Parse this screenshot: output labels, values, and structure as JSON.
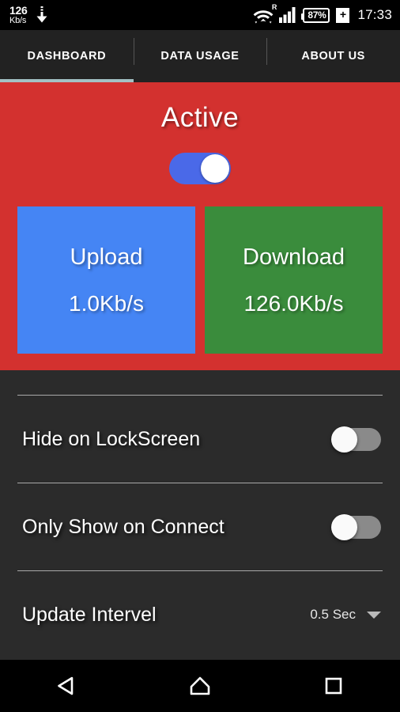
{
  "statusbar": {
    "speed_value": "126",
    "speed_unit": "Kb/s",
    "download_arrow_icon": "download-arrow-icon",
    "wifi_icon": "wifi-icon",
    "roaming_label": "R",
    "signal_icon": "cellular-signal-icon",
    "battery_percent": "87%",
    "battery_plus": "+",
    "clock": "17:33"
  },
  "tabs": [
    {
      "label": "DASHBOARD",
      "active": true
    },
    {
      "label": "DATA USAGE",
      "active": false
    },
    {
      "label": "ABOUT US",
      "active": false
    }
  ],
  "dashboard": {
    "status_title": "Active",
    "master_switch_on": true,
    "cards": [
      {
        "title": "Upload",
        "value": "1.0Kb/s",
        "color": "#4585f4"
      },
      {
        "title": "Download",
        "value": "126.0Kb/s",
        "color": "#3a8c3c"
      }
    ],
    "panel_color": "#d3312f"
  },
  "settings": {
    "rows": [
      {
        "label": "Hide on LockScreen",
        "type": "switch",
        "value": "off"
      },
      {
        "label": "Only Show on Connect",
        "type": "switch",
        "value": "off"
      },
      {
        "label": "Update Intervel",
        "type": "spinner",
        "value": "0.5 Sec",
        "caret_icon": "chevron-down-icon"
      }
    ]
  },
  "navbar": {
    "back_icon": "back-triangle-icon",
    "home_icon": "home-icon",
    "recents_icon": "recents-square-icon"
  }
}
